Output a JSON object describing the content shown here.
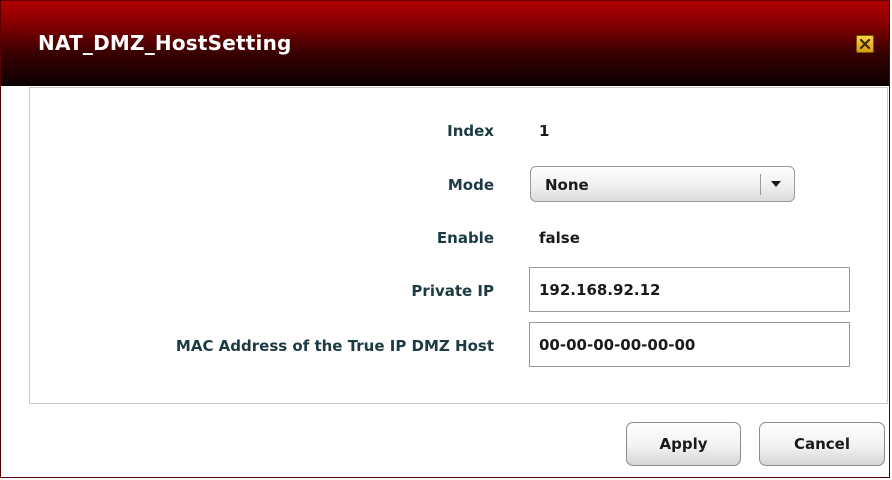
{
  "dialog": {
    "title": "NAT_DMZ_HostSetting",
    "close_icon": "close-icon",
    "accent_colors": {
      "titlebar_top": "#b00000",
      "titlebar_bottom": "#0d0000",
      "close_button": "#e8b526"
    }
  },
  "form": {
    "index": {
      "label": "Index",
      "value": "1"
    },
    "mode": {
      "label": "Mode",
      "selected": "None",
      "dropdown_icon": "chevron-down-icon"
    },
    "enable": {
      "label": "Enable",
      "value": "false"
    },
    "private_ip": {
      "label": "Private IP",
      "value": "192.168.92.12"
    },
    "mac_address": {
      "label": "MAC Address of the True IP DMZ Host",
      "value": "00-00-00-00-00-00"
    }
  },
  "buttons": {
    "apply": "Apply",
    "cancel": "Cancel"
  }
}
